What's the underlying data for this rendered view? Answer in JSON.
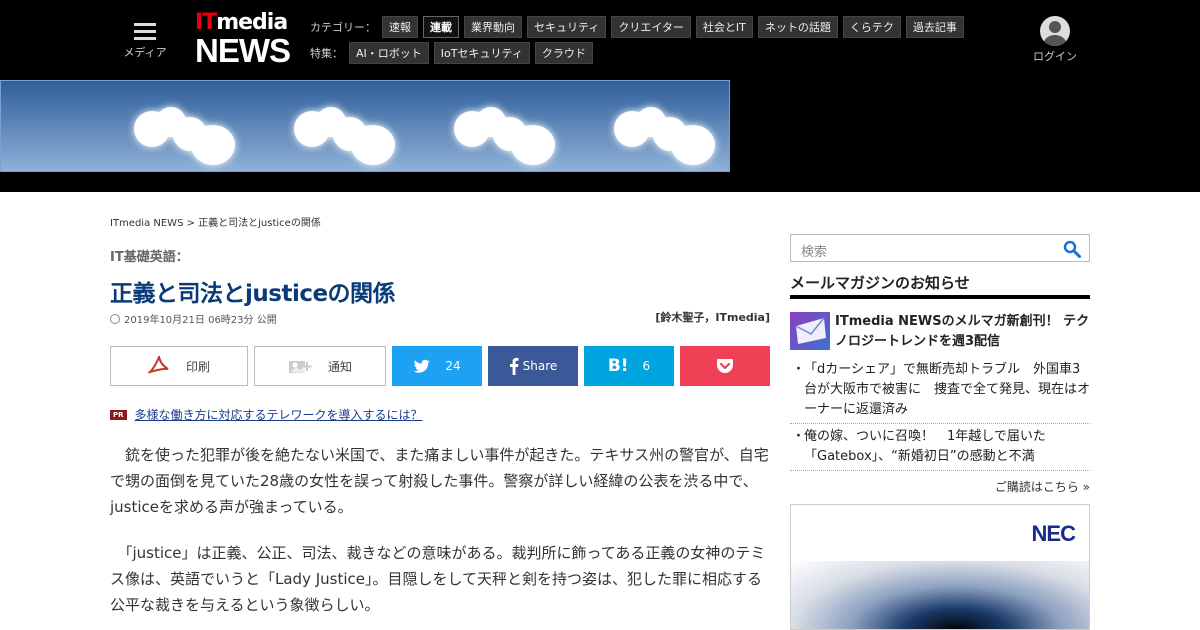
{
  "header": {
    "menu_label": "メディア",
    "logo_it": "IT",
    "logo_media": "media",
    "logo_news": "NEWS",
    "category_label": "カテゴリー：",
    "categories": [
      {
        "label": "速報",
        "active": false
      },
      {
        "label": "連載",
        "active": true
      },
      {
        "label": "業界動向",
        "active": false
      },
      {
        "label": "セキュリティ",
        "active": false
      },
      {
        "label": "クリエイター",
        "active": false
      },
      {
        "label": "社会とIT",
        "active": false
      },
      {
        "label": "ネットの話題",
        "active": false
      },
      {
        "label": "くらテク",
        "active": false
      },
      {
        "label": "過去記事",
        "active": false
      }
    ],
    "feature_label": "特集：",
    "features": [
      {
        "label": "AI・ロボット"
      },
      {
        "label": "IoTセキュリティ"
      },
      {
        "label": "クラウド"
      }
    ],
    "login_label": "ログイン"
  },
  "breadcrumb": "ITmedia NEWS > 正義と司法とjusticeの関係",
  "article": {
    "kicker": "IT基礎英語：",
    "title": "正義と司法とjusticeの関係",
    "date": "2019年10月21日 06時23分 公開",
    "author": "[鈴木聖子，ITmedia]",
    "share": {
      "print_label": "印刷",
      "notify_label": "通知",
      "twitter_count": "24",
      "facebook_label": "Share",
      "hatena_icon": "B!",
      "hatena_count": "6"
    },
    "pr_badge": "PR",
    "pr_link": "多様な働き方に対応するテレワークを導入するには？",
    "paragraphs": [
      "　銃を使った犯罪が後を絶たない米国で、また痛ましい事件が起きた。テキサス州の警官が、自宅で甥の面倒を見ていた28歳の女性を誤って射殺した事件。警察が詳しい経緯の公表を渋る中で、justiceを求める声が強まっている。",
      "　「justice」は正義、公正、司法、裁きなどの意味がある。裁判所に飾ってある正義の女神のテミス像は、英語でいうと「Lady Justice」。目隠しをして天秤と剣を持つ姿は、犯した罪に相応する公平な裁きを与えるという象徴らしい。"
    ]
  },
  "sidebar": {
    "search_placeholder": "検索",
    "newsletter_title": "メールマガジンのお知らせ",
    "newsletter_headline": "ITmedia NEWSのメルマガ新創刊！ テクノロジートレンドを週3配信",
    "items": [
      "「dカーシェア」で無断売却トラブル　外国車3台が大阪市で被害に　捜査で全て発見、現在はオーナーに返還済み",
      "俺の嫁、ついに召喚！　1年越しで届いた「Gatebox」、“新婚初日”の感動と不満"
    ],
    "subscribe_label": "ご購読はこちら »",
    "ad_logo": "NEC"
  },
  "colors": {
    "title": "#0a3b78",
    "twitter": "#1da1f2",
    "facebook": "#3b5998",
    "hatena": "#00a4de",
    "pocket": "#ef4056",
    "topbar": "#000000"
  }
}
